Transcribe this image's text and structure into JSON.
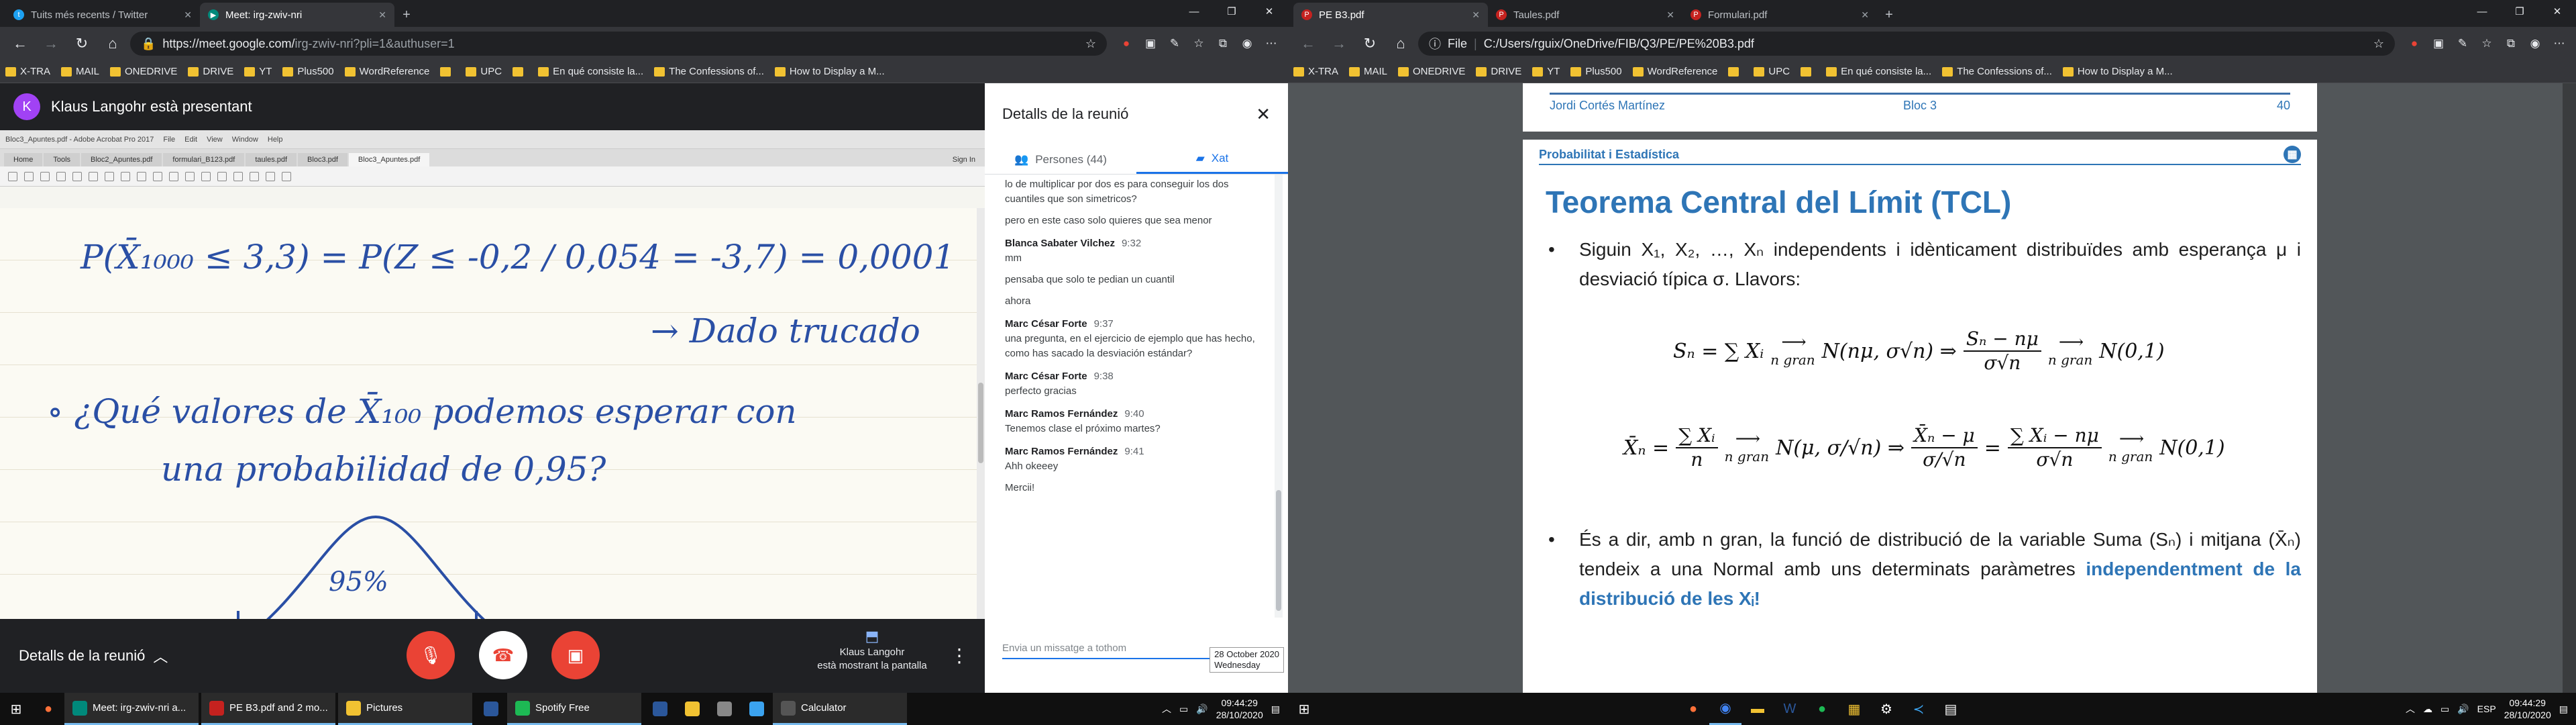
{
  "left": {
    "tabs": [
      {
        "label": "Tuits més recents / Twitter",
        "active": false
      },
      {
        "label": "Meet: irg-zwiv-nri",
        "active": true
      }
    ],
    "url_main": "https://meet.google.com/",
    "url_rest": "irg-zwiv-nri?pli=1&authuser=1",
    "bookmarks": [
      "X-TRA",
      "MAIL",
      "ONEDRIVE",
      "DRIVE",
      "YT",
      "Plus500",
      "WordReference",
      "",
      "UPC",
      "",
      "En qué consiste la...",
      "The Confessions of...",
      "How to Display a M..."
    ],
    "meet": {
      "avatar_letter": "K",
      "presenting": "Klaus Langohr està presentant",
      "details_button": "Detalls de la reunió",
      "presenter_line1": "Klaus Langohr",
      "presenter_line2": "està mostrant la pantalla"
    },
    "acrobat": {
      "title": "Bloc3_Apuntes.pdf - Adobe Acrobat Pro 2017",
      "menu": [
        "File",
        "Edit",
        "View",
        "Window",
        "Help"
      ],
      "tabs": [
        "Home",
        "Tools",
        "Bloc2_Apuntes.pdf",
        "formulari_B123.pdf",
        "taules.pdf",
        "Bloc3.pdf",
        "Bloc3_Apuntes.pdf"
      ],
      "sign_in": "Sign In"
    },
    "handwriting": {
      "line1": "P(X̄₁₀₀₀ ≤ 3,3) = P(Z ≤ -0,2 / 0,054 = -3,7) = 0,0001",
      "line2": "→ Dado trucado",
      "line3": "∘ ¿Qué valores de X̄₁₀₀ podemos esperar con",
      "line4": "una probabilidad de 0,95?",
      "curve_label": "95%"
    },
    "panel": {
      "title": "Detalls de la reunió",
      "tab_people": "Persones (44)",
      "tab_chat": "Xat",
      "messages": [
        {
          "sender": "",
          "time": "",
          "lines": [
            "lo de multiplicar por dos es para conseguir los dos cuantiles que son simetricos?",
            "pero en este caso solo quieres que sea menor"
          ]
        },
        {
          "sender": "Blanca Sabater Vilchez",
          "time": "9:32",
          "lines": [
            "mm",
            "pensaba que solo te pedian un cuantil",
            "ahora"
          ]
        },
        {
          "sender": "Marc César Forte",
          "time": "9:37",
          "lines": [
            "una pregunta, en el ejercicio de ejemplo que has hecho, como has sacado la desviación estándar?"
          ]
        },
        {
          "sender": "Marc César Forte",
          "time": "9:38",
          "lines": [
            "perfecto gracias"
          ]
        },
        {
          "sender": "Marc Ramos Fernández",
          "time": "9:40",
          "lines": [
            "Tenemos clase el próximo martes?"
          ]
        },
        {
          "sender": "Marc Ramos Fernández",
          "time": "9:41",
          "lines": [
            "Ahh okeeey",
            "Mercii!"
          ]
        }
      ],
      "input_placeholder": "Envia un missatge a tothom",
      "tooltip_line1": "28 October 2020",
      "tooltip_line2": "Wednesday"
    }
  },
  "right": {
    "tabs": [
      {
        "label": "PE B3.pdf",
        "active": true
      },
      {
        "label": "Taules.pdf",
        "active": false
      },
      {
        "label": "Formulari.pdf",
        "active": false
      }
    ],
    "file_label": "File",
    "url": "C:/Users/rguix/OneDrive/FIB/Q3/PE/PE%20B3.pdf",
    "bookmarks": [
      "X-TRA",
      "MAIL",
      "ONEDRIVE",
      "DRIVE",
      "YT",
      "Plus500",
      "WordReference",
      "",
      "UPC",
      "",
      "En qué consiste la...",
      "The Confessions of...",
      "How to Display a M..."
    ],
    "pdf": {
      "footer_author": "Jordi Cortés Martínez",
      "footer_block": "Bloc 3",
      "footer_page": "40",
      "header": "Probabilitat i Estadística",
      "title": "Teorema Central del Límit (TCL)",
      "bullet1": "Siguin X₁, X₂, …, Xₙ independents i idènticament distribuïdes amb esperança μ i desviació típica σ. Llavors:",
      "formula1_left": "Sₙ = ∑ Xᵢ",
      "formula1_mid": "N(nμ, σ√n)  ⇒",
      "formula1_num": "Sₙ − nμ",
      "formula1_den": "σ√n",
      "formula1_right": "N(0,1)",
      "formula2_lhs": "X̄ₙ =",
      "formula2_num1": "∑ Xᵢ",
      "formula2_den1": "n",
      "formula2_mid": "N(μ, σ/√n)  ⇒",
      "formula2_num2": "X̄ₙ − μ",
      "formula2_den2": "σ/√n",
      "formula2_eq": "=",
      "formula2_num3": "∑ Xᵢ − nμ",
      "formula2_den3": "σ√n",
      "formula2_right": "N(0,1)",
      "arrow_label": "n gran",
      "bullet2_plain": "És a dir, amb n gran, la funció de distribució de la variable Suma (Sₙ) i mitjana (X̄ₙ) tendeix a una Normal amb uns determinats paràmetres ",
      "bullet2_bold": "independentment de la distribució de les Xᵢ!"
    }
  },
  "taskbar": {
    "left_apps": [
      "Meet: irg-zwiv-nri a...",
      "PE B3.pdf and 2 mo...",
      "Pictures",
      "",
      "Spotify Free",
      "",
      "",
      "",
      "",
      "Calculator"
    ],
    "time": "09:44:29",
    "date": "28/10/2020",
    "lang": "ESP"
  }
}
